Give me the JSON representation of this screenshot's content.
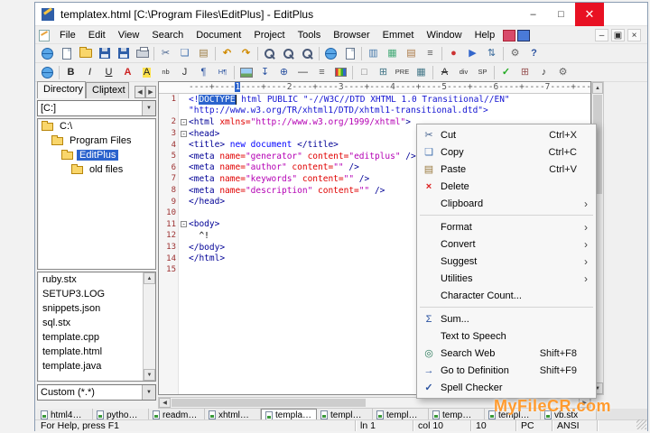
{
  "colors": {
    "selection": "#2b63cd",
    "close_button": "#e81123",
    "watermark": "#ff9b2f",
    "tag": "#000096",
    "attribute": "#e00000",
    "string": "#b400b4",
    "doctype": "#1414d2",
    "line_number": "#9c3030"
  },
  "window": {
    "title": "templatex.html [C:\\Program Files\\EditPlus] - EditPlus",
    "controls": {
      "minimize": "–",
      "maximize": "□",
      "close": "✕"
    },
    "mdi": {
      "minimize": "–",
      "restore": "▣",
      "close": "×"
    }
  },
  "menu_bar": {
    "items": [
      "File",
      "Edit",
      "View",
      "Search",
      "Document",
      "Project",
      "Tools",
      "Browser",
      "Emmet",
      "Window",
      "Help"
    ]
  },
  "toolbar_main": [
    {
      "n": "browser-sync-icon",
      "shape": "globe"
    },
    {
      "n": "new-document-icon",
      "shape": "page"
    },
    {
      "n": "open-file-icon",
      "shape": "folder"
    },
    {
      "n": "save-icon",
      "shape": "floppy"
    },
    {
      "n": "save-all-icon",
      "shape": "floppy"
    },
    {
      "n": "print-icon",
      "shape": "printer"
    },
    {
      "sep": true
    },
    {
      "n": "cut-icon",
      "g": "✂",
      "c": "#44618e"
    },
    {
      "n": "copy-icon",
      "g": "❏",
      "c": "#3f6fae"
    },
    {
      "n": "paste-icon",
      "g": "▤",
      "c": "#9a7a3f"
    },
    {
      "sep": true
    },
    {
      "n": "undo-icon",
      "g": "↶",
      "c": "#d08a00",
      "b": 1
    },
    {
      "n": "redo-icon",
      "g": "↷",
      "c": "#d08a00",
      "b": 1
    },
    {
      "sep": true
    },
    {
      "n": "find-icon",
      "shape": "mag"
    },
    {
      "n": "replace-icon",
      "shape": "mag"
    },
    {
      "n": "find-in-files-icon",
      "shape": "mag"
    },
    {
      "sep": true
    },
    {
      "n": "browser-window-icon",
      "shape": "globe"
    },
    {
      "n": "view-in-browser-icon",
      "shape": "page"
    },
    {
      "sep": true
    },
    {
      "n": "cliptext-window-icon",
      "g": "▥",
      "c": "#4477aa"
    },
    {
      "n": "directory-window-icon",
      "g": "▦",
      "c": "#44aa77"
    },
    {
      "n": "output-window-icon",
      "g": "▤",
      "c": "#aa7744"
    },
    {
      "n": "document-selector-icon",
      "g": "≡",
      "c": "#555555"
    },
    {
      "sep": true
    },
    {
      "n": "record-macro-icon",
      "g": "●",
      "c": "#cc3333"
    },
    {
      "n": "play-macro-icon",
      "g": "▶",
      "c": "#3366cc"
    },
    {
      "n": "sort-icon",
      "g": "⇅",
      "c": "#336699"
    },
    {
      "sep": true
    },
    {
      "n": "settings-icon",
      "g": "⚙",
      "c": "#666666"
    },
    {
      "n": "help-icon",
      "g": "?",
      "c": "#2a52a0",
      "b": 1
    }
  ],
  "toolbar_html": [
    {
      "n": "browser-preview-icon",
      "shape": "globe"
    },
    {
      "sep": true
    },
    {
      "n": "bold-icon",
      "g": "B",
      "c": "#222222",
      "b": 1
    },
    {
      "n": "italic-icon",
      "g": "I",
      "c": "#222222",
      "i": 1
    },
    {
      "n": "underline-icon",
      "g": "U",
      "c": "#222222",
      "u": 1
    },
    {
      "n": "font-color-icon",
      "g": "A",
      "c": "#cc2222",
      "b": 1
    },
    {
      "n": "highlight-icon",
      "g": "A",
      "c": "#222222",
      "bg": "#ffe34d"
    },
    {
      "n": "nbsp-icon",
      "g": "nb",
      "c": "#333333",
      "sm": 1
    },
    {
      "n": "line-break-icon",
      "g": "J",
      "c": "#333333"
    },
    {
      "n": "paragraph-icon",
      "g": "¶",
      "c": "#2a52a0"
    },
    {
      "n": "heading-icon",
      "g": "H¶",
      "c": "#2a52a0",
      "sm": 1
    },
    {
      "sep": true
    },
    {
      "n": "image-icon",
      "shape": "img"
    },
    {
      "n": "anchor-icon",
      "g": "↧",
      "c": "#2a52a0"
    },
    {
      "n": "hyperlink-icon",
      "g": "⊕",
      "c": "#2a52a0"
    },
    {
      "n": "horizontal-rule-icon",
      "g": "—",
      "c": "#333333"
    },
    {
      "n": "list-icon",
      "g": "≡",
      "c": "#555555"
    },
    {
      "n": "color-picker-icon",
      "shape": "palette"
    },
    {
      "sep": true
    },
    {
      "n": "form-icon",
      "g": "□",
      "c": "#777777"
    },
    {
      "n": "table-icon",
      "g": "⊞",
      "c": "#447788"
    },
    {
      "n": "pre-icon",
      "g": "PRE",
      "c": "#333333",
      "sm": 1
    },
    {
      "n": "frame-icon",
      "g": "▦",
      "c": "#447788"
    },
    {
      "sep": true
    },
    {
      "n": "strikethrough-icon",
      "g": "A",
      "c": "#333333",
      "s": 1
    },
    {
      "n": "div-icon",
      "g": "div",
      "c": "#333333",
      "sm": 1
    },
    {
      "n": "span-icon",
      "g": "SP",
      "c": "#333333",
      "sm": 1
    },
    {
      "sep": true
    },
    {
      "n": "check-icon",
      "g": "✓",
      "c": "#22aa22",
      "b": 1
    },
    {
      "n": "table2-icon",
      "g": "⊞",
      "c": "#995555"
    },
    {
      "n": "music-icon",
      "g": "♪",
      "c": "#333333"
    },
    {
      "n": "tools-icon",
      "g": "⚙",
      "c": "#666666"
    }
  ],
  "sidebar": {
    "tabs": [
      {
        "label": "Directory",
        "active": true
      },
      {
        "label": "Cliptext",
        "active": false
      }
    ],
    "drive_selector": "[C:]",
    "tree": [
      {
        "label": "C:\\",
        "level": 0,
        "selected": false
      },
      {
        "label": "Program Files",
        "level": 1,
        "selected": false
      },
      {
        "label": "EditPlus",
        "level": 2,
        "selected": true
      },
      {
        "label": "old files",
        "level": 3,
        "selected": false
      }
    ],
    "files": [
      "ruby.stx",
      "SETUP3.LOG",
      "snippets.json",
      "sql.stx",
      "template.cpp",
      "template.html",
      "template.java"
    ],
    "filter": "Custom (*.*)"
  },
  "editor": {
    "ruler": {
      "pre": "----+----",
      "marker": "1",
      "post": "----+----2----+----3----+----4----+----5----+----6----+----7----+---"
    },
    "lines": [
      {
        "num": "1",
        "segs": [
          {
            "c": "doctype",
            "t": "<!"
          },
          {
            "c": "sel",
            "t": "DOCTYPE"
          },
          {
            "c": "caret",
            "t": ""
          },
          {
            "c": "doctype",
            "t": " html PUBLIC \"-//W3C//DTD XHTML 1.0 Transitional//EN\""
          }
        ]
      },
      {
        "num": "",
        "segs": [
          {
            "c": "doctype",
            "t": "\"http://www.w3.org/TR/xhtml1/DTD/xhtml1-transitional.dtd\">"
          }
        ]
      },
      {
        "num": "2",
        "fold": true,
        "segs": [
          {
            "c": "tag",
            "t": "<html "
          },
          {
            "c": "attr",
            "t": "xmlns="
          },
          {
            "c": "str",
            "t": "\"http://www.w3.org/1999/xhtml\""
          },
          {
            "c": "tag",
            "t": ">"
          }
        ]
      },
      {
        "num": "3",
        "fold": true,
        "segs": [
          {
            "c": "tag",
            "t": "<head>"
          }
        ]
      },
      {
        "num": "4",
        "segs": [
          {
            "c": "tag",
            "t": "<title>"
          },
          {
            "c": "text",
            "t": " new document "
          },
          {
            "c": "tag",
            "t": "</title>"
          }
        ]
      },
      {
        "num": "5",
        "segs": [
          {
            "c": "tag",
            "t": "<meta "
          },
          {
            "c": "attr",
            "t": "name="
          },
          {
            "c": "str",
            "t": "\"generator\""
          },
          {
            "c": "attr",
            "t": " content="
          },
          {
            "c": "str",
            "t": "\"editplus\""
          },
          {
            "c": "tag",
            "t": " />"
          }
        ]
      },
      {
        "num": "6",
        "segs": [
          {
            "c": "tag",
            "t": "<meta "
          },
          {
            "c": "attr",
            "t": "name="
          },
          {
            "c": "str",
            "t": "\"author\""
          },
          {
            "c": "attr",
            "t": " content="
          },
          {
            "c": "str",
            "t": "\"\""
          },
          {
            "c": "tag",
            "t": " />"
          }
        ]
      },
      {
        "num": "7",
        "segs": [
          {
            "c": "tag",
            "t": "<meta "
          },
          {
            "c": "attr",
            "t": "name="
          },
          {
            "c": "str",
            "t": "\"keywords\""
          },
          {
            "c": "attr",
            "t": " content="
          },
          {
            "c": "str",
            "t": "\"\""
          },
          {
            "c": "tag",
            "t": " />"
          }
        ]
      },
      {
        "num": "8",
        "segs": [
          {
            "c": "tag",
            "t": "<meta "
          },
          {
            "c": "attr",
            "t": "name="
          },
          {
            "c": "str",
            "t": "\"description\""
          },
          {
            "c": "attr",
            "t": " content="
          },
          {
            "c": "str",
            "t": "\"\""
          },
          {
            "c": "tag",
            "t": " />"
          }
        ]
      },
      {
        "num": "9",
        "segs": [
          {
            "c": "tag",
            "t": "</head>"
          }
        ]
      },
      {
        "num": "10",
        "segs": []
      },
      {
        "num": "11",
        "fold": true,
        "segs": [
          {
            "c": "tag",
            "t": "<body>"
          }
        ]
      },
      {
        "num": "12",
        "segs": [
          {
            "c": "plain",
            "t": "  ^!"
          }
        ]
      },
      {
        "num": "13",
        "segs": [
          {
            "c": "tag",
            "t": "</body>"
          }
        ]
      },
      {
        "num": "14",
        "segs": [
          {
            "c": "tag",
            "t": "</html>"
          }
        ]
      },
      {
        "num": "15",
        "segs": []
      }
    ]
  },
  "context_menu": {
    "items": [
      {
        "label": "Cut",
        "shortcut": "Ctrl+X",
        "icon": "cut"
      },
      {
        "label": "Copy",
        "shortcut": "Ctrl+C",
        "icon": "copy"
      },
      {
        "label": "Paste",
        "shortcut": "Ctrl+V",
        "icon": "paste"
      },
      {
        "label": "Delete",
        "icon": "delete"
      },
      {
        "label": "Clipboard",
        "submenu": true
      },
      {
        "separator": true
      },
      {
        "label": "Format",
        "submenu": true
      },
      {
        "label": "Convert",
        "submenu": true
      },
      {
        "label": "Suggest",
        "submenu": true
      },
      {
        "label": "Utilities",
        "submenu": true
      },
      {
        "label": "Character Count..."
      },
      {
        "separator": true
      },
      {
        "label": "Sum...",
        "icon": "sum"
      },
      {
        "label": "Text to Speech"
      },
      {
        "label": "Search Web",
        "shortcut": "Shift+F8",
        "icon": "search-web"
      },
      {
        "label": "Go to Definition",
        "shortcut": "Shift+F9",
        "icon": "goto-def"
      },
      {
        "label": "Spell Checker",
        "icon": "spell"
      }
    ],
    "icons": {
      "cut": {
        "g": "✂",
        "c": "#44618e"
      },
      "copy": {
        "g": "❏",
        "c": "#3f6fae"
      },
      "paste": {
        "g": "▤",
        "c": "#9a7a3f"
      },
      "delete": {
        "g": "×",
        "c": "#dd2222",
        "b": 1
      },
      "sum": {
        "g": "Σ",
        "c": "#2a52a0"
      },
      "search-web": {
        "g": "◎",
        "c": "#2a7a5a"
      },
      "goto-def": {
        "g": "→",
        "c": "#2a52a0",
        "b": 1
      },
      "spell": {
        "g": "✓",
        "c": "#2a52a0",
        "b": 1
      }
    }
  },
  "doc_tabs": {
    "labels": [
      "html4…",
      "pytho…",
      "readm…",
      "xhtml…",
      "templa…",
      "templ…",
      "templ…",
      "temp…",
      "templ…",
      "vb.stx"
    ],
    "active_index": 4
  },
  "status_bar": {
    "help": "For Help, press F1",
    "cells": [
      "ln 1",
      "col 10",
      "10",
      "PC",
      "ANSI",
      ""
    ]
  },
  "watermark": {
    "text": "MyFileCR.com"
  }
}
